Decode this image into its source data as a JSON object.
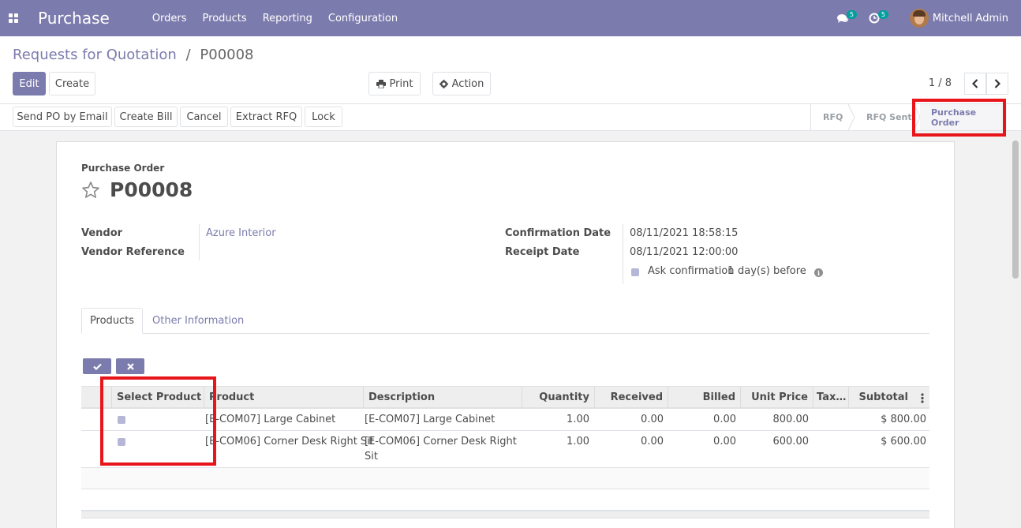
{
  "navbar": {
    "app_name": "Purchase",
    "menu": [
      "Orders",
      "Products",
      "Reporting",
      "Configuration"
    ],
    "messages_count": "5",
    "activities_count": "5",
    "user_name": "Mitchell Admin",
    "bg_color": "#7c7bad"
  },
  "control_panel": {
    "breadcrumb_parent": "Requests for Quotation",
    "breadcrumb_sep": "/",
    "breadcrumb_current": "P00008",
    "edit_label": "Edit",
    "create_label": "Create",
    "print_label": "Print",
    "action_label": "Action",
    "pager": "1 / 8"
  },
  "statusbar": {
    "buttons": [
      "Send PO by Email",
      "Create Bill",
      "Cancel",
      "Extract RFQ",
      "Lock"
    ],
    "stages": [
      "RFQ",
      "RFQ Sent",
      "Purchase Order"
    ],
    "active_stage": "Purchase Order"
  },
  "form": {
    "record_type": "Purchase Order",
    "record_name": "P00008",
    "vendor_label": "Vendor",
    "vendor_value": "Azure Interior",
    "vendor_ref_label": "Vendor Reference",
    "confirmation_date_label": "Confirmation Date",
    "confirmation_date_value": "08/11/2021 18:58:15",
    "receipt_date_label": "Receipt Date",
    "receipt_date_value": "08/11/2021 12:00:00",
    "ask_confirmation_label": "Ask confirmation",
    "ask_confirmation_days": "1",
    "ask_confirmation_suffix": "day(s) before"
  },
  "tabs": {
    "products": "Products",
    "other_info": "Other Information"
  },
  "table": {
    "headers": {
      "select_product": "Select Product",
      "product": "Product",
      "description": "Description",
      "quantity": "Quantity",
      "received": "Received",
      "billed": "Billed",
      "unit_price": "Unit Price",
      "taxes": "Tax…",
      "subtotal": "Subtotal"
    },
    "rows": [
      {
        "selected": true,
        "product": "[E-COM07] Large Cabinet",
        "description": "[E-COM07] Large Cabinet",
        "description_2": "",
        "quantity": "1.00",
        "received": "0.00",
        "billed": "0.00",
        "unit_price": "800.00",
        "subtotal": "$ 800.00"
      },
      {
        "selected": true,
        "product": "[E-COM06] Corner Desk Right Sit",
        "description": "[E-COM06] Corner Desk Right",
        "description_2": "Sit",
        "quantity": "1.00",
        "received": "0.00",
        "billed": "0.00",
        "unit_price": "600.00",
        "subtotal": "$ 600.00"
      }
    ]
  },
  "colors": {
    "brand": "#7c7bad",
    "highlight": "#e8151b"
  }
}
